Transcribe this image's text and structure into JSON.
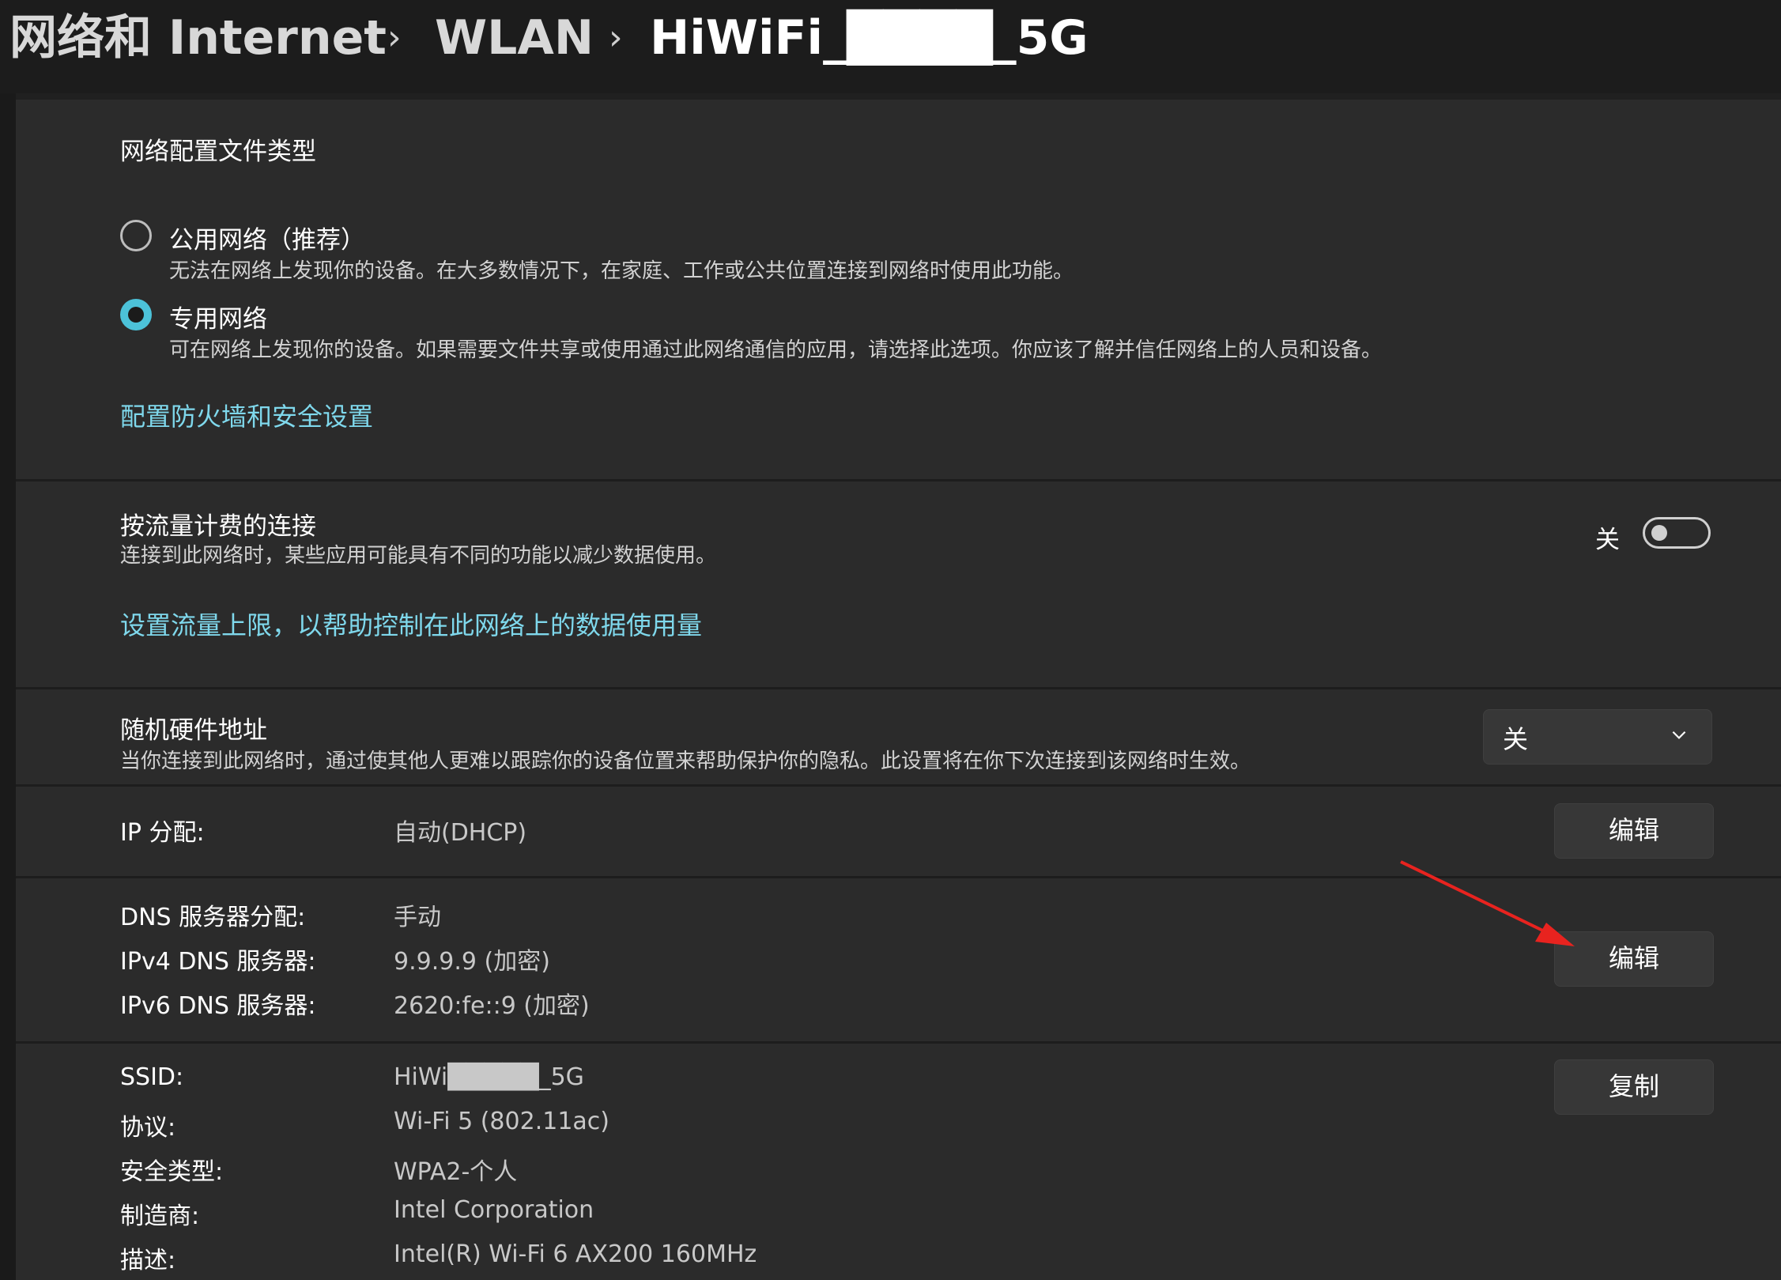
{
  "breadcrumb": {
    "items": [
      "网络和 Internet",
      "WLAN",
      "HiWiFi_████_5G"
    ],
    "separator": "›"
  },
  "profile": {
    "section_title": "网络配置文件类型",
    "public_label": "公用网络（推荐）",
    "public_desc": "无法在网络上发现你的设备。在大多数情况下，在家庭、工作或公共位置连接到网络时使用此功能。",
    "private_label": "专用网络",
    "private_desc": "可在网络上发现你的设备。如果需要文件共享或使用通过此网络通信的应用，请选择此选项。你应该了解并信任网络上的人员和设备。",
    "selected": "private",
    "firewall_link": "配置防火墙和安全设置"
  },
  "metered": {
    "title": "按流量计费的连接",
    "desc": "连接到此网络时，某些应用可能具有不同的功能以减少数据使用。",
    "toggle_state": "关",
    "toggle_on": false,
    "data_limit_link": "设置流量上限，以帮助控制在此网络上的数据使用量"
  },
  "random_hw": {
    "title": "随机硬件地址",
    "desc": "当你连接到此网络时，通过使其他人更难以跟踪你的设备位置来帮助保护你的隐私。此设置将在你下次连接到该网络时生效。",
    "dropdown_value": "关"
  },
  "ip": {
    "label": "IP 分配:",
    "value": "自动(DHCP)",
    "edit_label": "编辑"
  },
  "dns": {
    "assign_label": "DNS 服务器分配:",
    "assign_value": "手动",
    "ipv4_label": "IPv4 DNS 服务器:",
    "ipv4_value": "9.9.9.9 (加密)",
    "ipv6_label": "IPv6 DNS 服务器:",
    "ipv6_value": "2620:fe::9 (加密)",
    "edit_label": "编辑"
  },
  "props": {
    "ssid_label": "SSID:",
    "ssid_value": "HiWi█████_5G",
    "protocol_label": "协议:",
    "protocol_value": "Wi-Fi 5 (802.11ac)",
    "security_label": "安全类型:",
    "security_value": "WPA2-个人",
    "manufacturer_label": "制造商:",
    "manufacturer_value": "Intel Corporation",
    "description_label": "描述:",
    "description_value": "Intel(R) Wi-Fi 6 AX200 160MHz",
    "copy_label": "复制"
  },
  "colors": {
    "accent": "#4cc2d9",
    "link": "#7fd8ec",
    "annotation_arrow": "#e8231f"
  },
  "icons": [
    "chevron-right-icon",
    "chevron-down-icon",
    "annotation-arrow"
  ]
}
